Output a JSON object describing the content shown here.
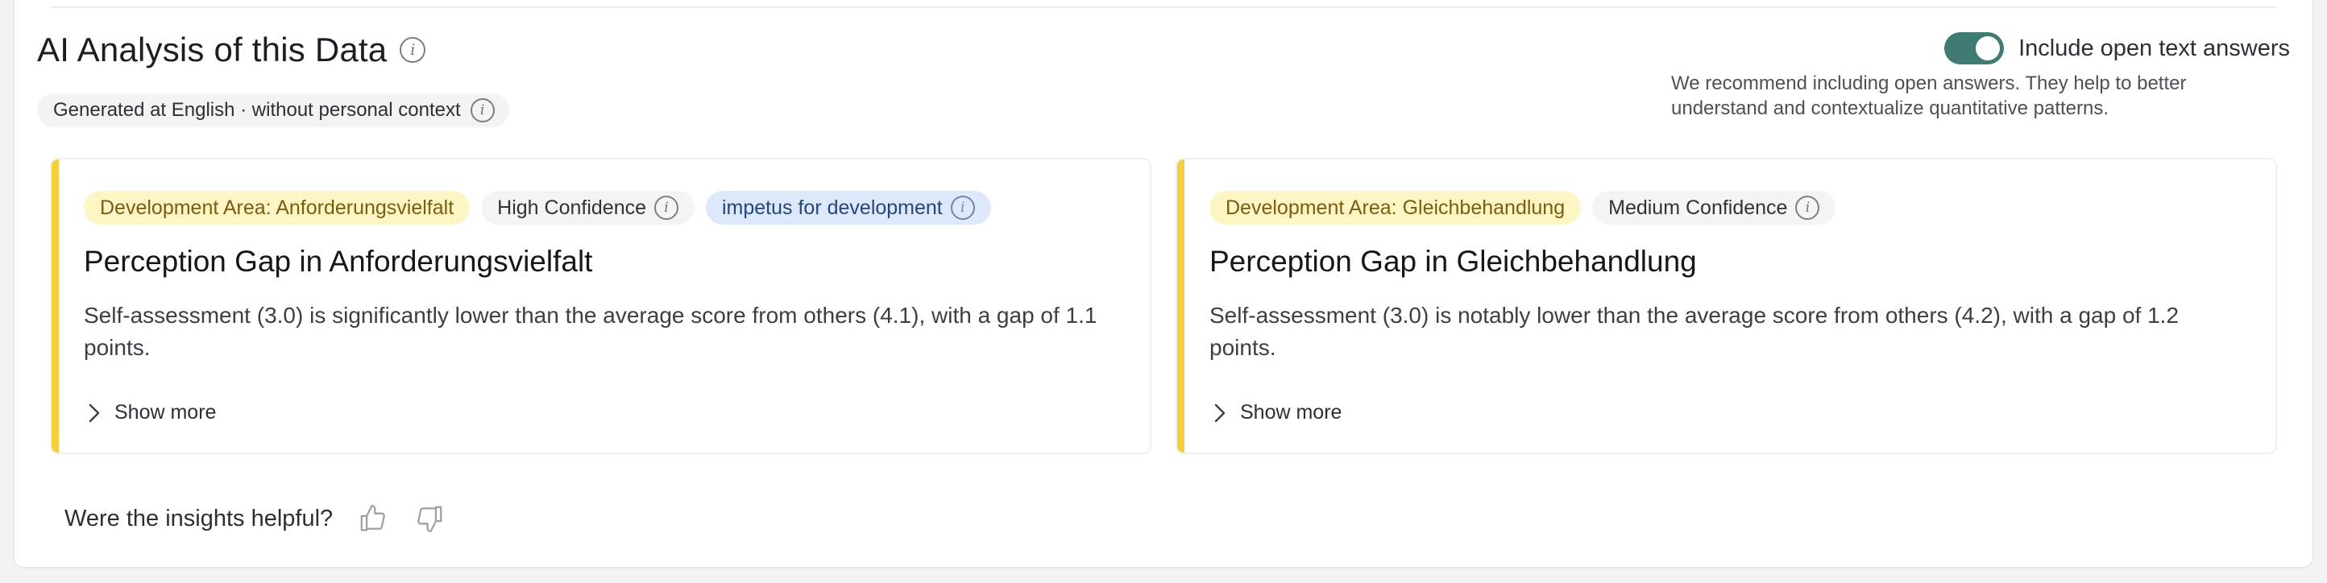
{
  "header": {
    "title": "AI Analysis of this Data",
    "meta": "Generated at English · without personal context"
  },
  "toggle": {
    "label": "Include open text answers",
    "enabled": true,
    "note": "We recommend including open answers. They help to better understand and contextualize quantitative patterns."
  },
  "cards": [
    {
      "area_tag": "Development Area: Anforderungsvielfalt",
      "confidence": "High Confidence",
      "extra_tag": "impetus for development",
      "title": "Perception Gap in Anforderungsvielfalt",
      "description": "Self-assessment (3.0) is significantly lower than the average score from others (4.1), with a gap of 1.1 points.",
      "show_more": "Show more"
    },
    {
      "area_tag": "Development Area: Gleichbehandlung",
      "confidence": "Medium Confidence",
      "title": "Perception Gap in Gleichbehandlung",
      "description": "Self-assessment (3.0) is notably lower than the average score from others (4.2), with a gap of 1.2 points.",
      "show_more": "Show more"
    }
  ],
  "feedback": {
    "question": "Were the insights helpful?"
  },
  "icons": {
    "info": "info-icon",
    "chevron": "chevron-right-icon",
    "thumbs_up": "thumbs-up-icon",
    "thumbs_down": "thumbs-down-icon"
  },
  "colors": {
    "accent_bar": "#f2cf3b",
    "toggle_on": "#3f7a73",
    "area_tag_bg": "#fdf5c3",
    "impetus_tag_bg": "#dde8fb"
  }
}
